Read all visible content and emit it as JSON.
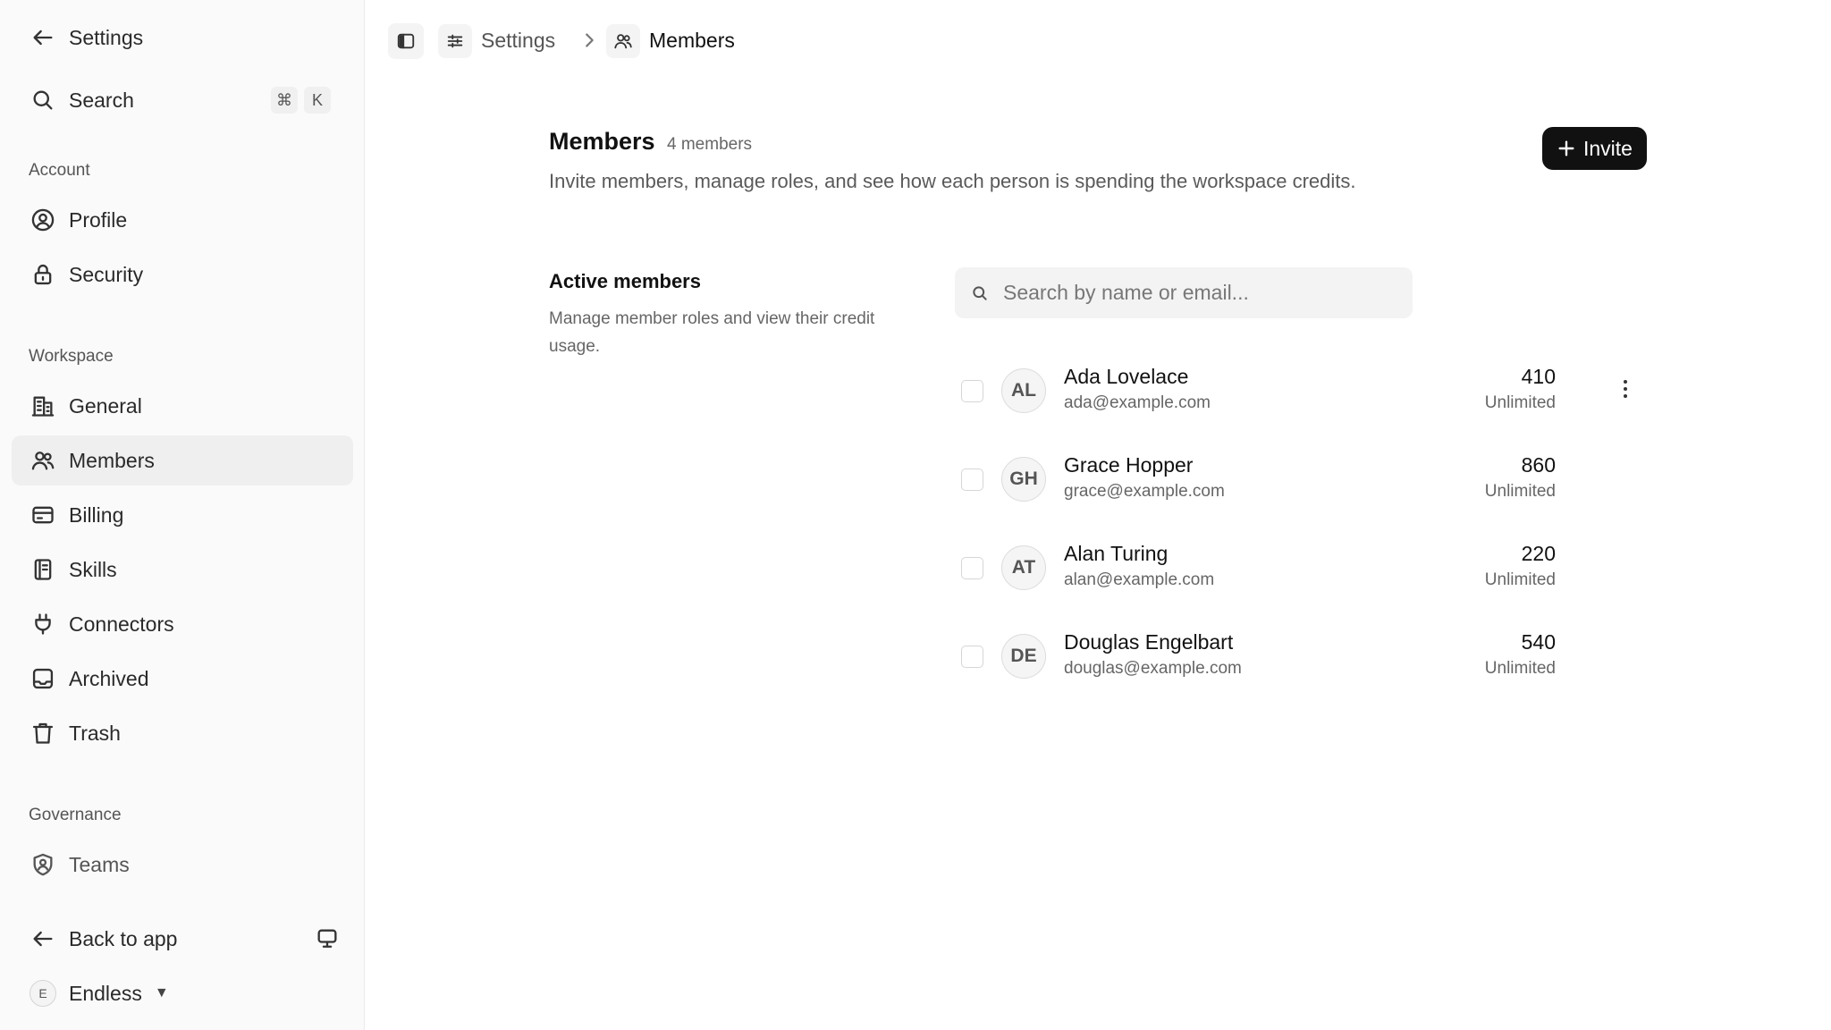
{
  "sidebar": {
    "back_label": "Settings",
    "search_label": "Search",
    "shortcut_keys": [
      "⌘",
      "K"
    ],
    "sections": {
      "account": "Account",
      "workspace": "Workspace",
      "governance": "Governance"
    },
    "account_items": [
      {
        "label": "Profile",
        "icon": "profile-icon"
      },
      {
        "label": "Security",
        "icon": "lock-icon"
      }
    ],
    "workspace_items": [
      {
        "label": "General",
        "icon": "building-icon"
      },
      {
        "label": "Members",
        "icon": "users-icon",
        "active": true
      },
      {
        "label": "Billing",
        "icon": "card-icon"
      },
      {
        "label": "Skills",
        "icon": "book-icon"
      },
      {
        "label": "Connectors",
        "icon": "plug-icon"
      },
      {
        "label": "Archived",
        "icon": "archive-icon"
      },
      {
        "label": "Trash",
        "icon": "trash-icon"
      }
    ],
    "governance_items": [
      {
        "label": "Teams",
        "icon": "shield-user-icon"
      }
    ],
    "back_to_app_label": "Back to app",
    "workspace_switcher": {
      "initial": "E",
      "name": "Endless"
    }
  },
  "breadcrumb": {
    "parent": "Settings",
    "current": "Members"
  },
  "header": {
    "title": "Members",
    "count": "4 members",
    "description": "Invite members, manage roles, and see how each person is spending the workspace credits.",
    "invite_label": "Invite"
  },
  "active_members": {
    "title": "Active members",
    "description": "Manage member roles and view their credit usage.",
    "search_placeholder": "Search by name or email...",
    "members": [
      {
        "initials": "AL",
        "name": "Ada Lovelace",
        "email": "ada@example.com",
        "credits": "410",
        "limit": "Unlimited"
      },
      {
        "initials": "GH",
        "name": "Grace Hopper",
        "email": "grace@example.com",
        "credits": "860",
        "limit": "Unlimited"
      },
      {
        "initials": "AT",
        "name": "Alan Turing",
        "email": "alan@example.com",
        "credits": "220",
        "limit": "Unlimited"
      },
      {
        "initials": "DE",
        "name": "Douglas Engelbart",
        "email": "douglas@example.com",
        "credits": "540",
        "limit": "Unlimited"
      }
    ]
  },
  "colors": {
    "primary_button": "#111111",
    "active_nav": "#efefef",
    "sidebar_bg": "#fafafa"
  }
}
